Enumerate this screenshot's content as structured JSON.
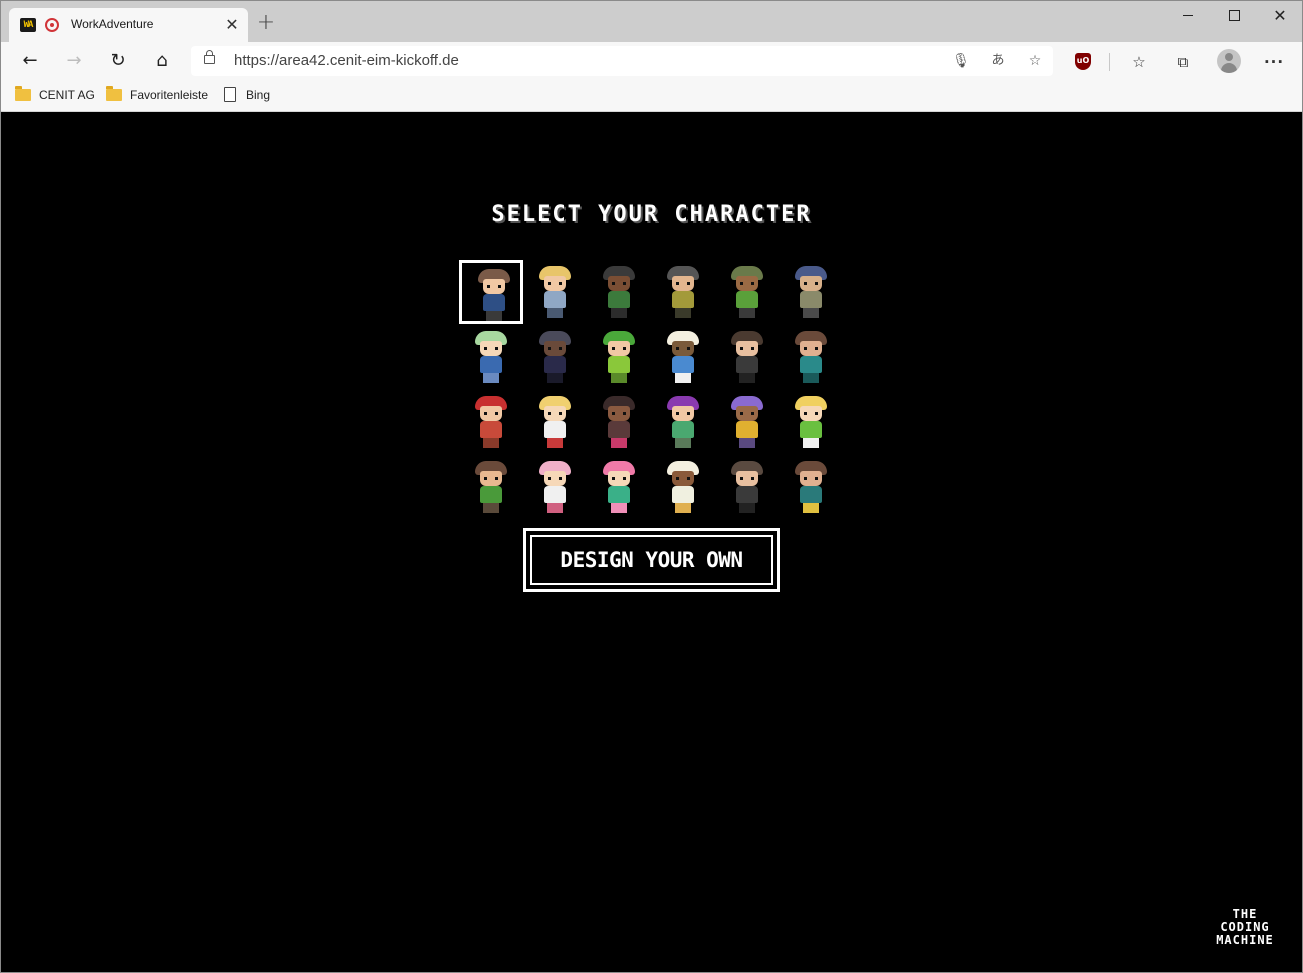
{
  "browser": {
    "tab": {
      "logo_text": "WA",
      "title": "WorkAdventure",
      "close": "✕"
    },
    "new_tab": "+",
    "window": {
      "minimize": "",
      "maximize": "",
      "close": "✕"
    },
    "nav": {
      "back": "←",
      "forward": "→",
      "reload": "↻",
      "home": "⌂"
    },
    "url": "https://area42.cenit-eim-kickoff.de",
    "omnibox_icons": {
      "mic": "🎙",
      "translate": "あ",
      "favorite_add": "☆"
    },
    "toolbar_icons": {
      "ublock": "uO",
      "favorites": "☆",
      "collections": "⧉",
      "menu": "···"
    },
    "bookmarks": [
      {
        "label": "CENIT AG",
        "icon": "folder-icon"
      },
      {
        "label": "Favoritenleiste",
        "icon": "folder-icon"
      },
      {
        "label": "Bing",
        "icon": "page-icon"
      }
    ]
  },
  "page": {
    "title": "SELECT YOUR CHARACTER",
    "design_button": "DESIGN YOUR OWN",
    "logo_lines": [
      "THE",
      "CODING",
      "MACHINE"
    ],
    "selected_index": 0,
    "characters": [
      {
        "hair": "#7a5a48",
        "skin": "#f1c8a4",
        "body": "#2e4f85",
        "legs": "#3a3a3a"
      },
      {
        "hair": "#e8c56a",
        "skin": "#f1c8a4",
        "body": "#8fa7c4",
        "legs": "#4a5a72"
      },
      {
        "hair": "#3a3a3a",
        "skin": "#7a4e34",
        "body": "#3c7a3c",
        "legs": "#2c2c2c"
      },
      {
        "hair": "#555555",
        "skin": "#e2b58e",
        "body": "#a39a3a",
        "legs": "#3a3a2a"
      },
      {
        "hair": "#6a7a4a",
        "skin": "#9a6a44",
        "body": "#5aa03a",
        "legs": "#3a3a3a"
      },
      {
        "hair": "#4a5a8a",
        "skin": "#d8b08a",
        "body": "#8a8a6a",
        "legs": "#4a4a4a"
      },
      {
        "hair": "#a8d8a0",
        "skin": "#f6d8b8",
        "body": "#3a6ab0",
        "legs": "#6a8ac0"
      },
      {
        "hair": "#4a4a5a",
        "skin": "#6a4a3a",
        "body": "#2a2a4a",
        "legs": "#1a1a2a"
      },
      {
        "hair": "#4aa83a",
        "skin": "#f1c8a4",
        "body": "#8ac83a",
        "legs": "#5a8a2a"
      },
      {
        "hair": "#f4f0e0",
        "skin": "#7a5a3a",
        "body": "#4a8ad0",
        "legs": "#f0f0f0"
      },
      {
        "hair": "#4a3a30",
        "skin": "#e8c0a0",
        "body": "#3a3a3a",
        "legs": "#222222"
      },
      {
        "hair": "#6a4a3a",
        "skin": "#e0b090",
        "body": "#2a8a8a",
        "legs": "#1a5a5a"
      },
      {
        "hair": "#c83030",
        "skin": "#f1c8a4",
        "body": "#c84a3a",
        "legs": "#8a3a2a"
      },
      {
        "hair": "#f0d070",
        "skin": "#f6d8b8",
        "body": "#f0f0f0",
        "legs": "#c83a3a"
      },
      {
        "hair": "#3a2a2a",
        "skin": "#8a5a40",
        "body": "#5a3a3a",
        "legs": "#c83a6a"
      },
      {
        "hair": "#8a3ab0",
        "skin": "#f1c8a4",
        "body": "#4aa870",
        "legs": "#5a7a5a"
      },
      {
        "hair": "#8a6ad0",
        "skin": "#9a6a48",
        "body": "#e0b030",
        "legs": "#5a4a80"
      },
      {
        "hair": "#f0d060",
        "skin": "#f6d8b8",
        "body": "#6ac040",
        "legs": "#f0f0f0"
      },
      {
        "hair": "#6a4a3a",
        "skin": "#e8b890",
        "body": "#4a9a3a",
        "legs": "#5a4a3a"
      },
      {
        "hair": "#f0b0c8",
        "skin": "#f6d8b8",
        "body": "#f0f0f0",
        "legs": "#d06080"
      },
      {
        "hair": "#f07aa8",
        "skin": "#f6d8b8",
        "body": "#3ab088",
        "legs": "#f090b8"
      },
      {
        "hair": "#f4f0e0",
        "skin": "#8a5a3a",
        "body": "#f0f0e0",
        "legs": "#e0b050"
      },
      {
        "hair": "#5a4a40",
        "skin": "#e8c0a0",
        "body": "#3a3a3a",
        "legs": "#222222"
      },
      {
        "hair": "#6a4a3a",
        "skin": "#e0b090",
        "body": "#2a7a7a",
        "legs": "#e0c040"
      }
    ]
  }
}
